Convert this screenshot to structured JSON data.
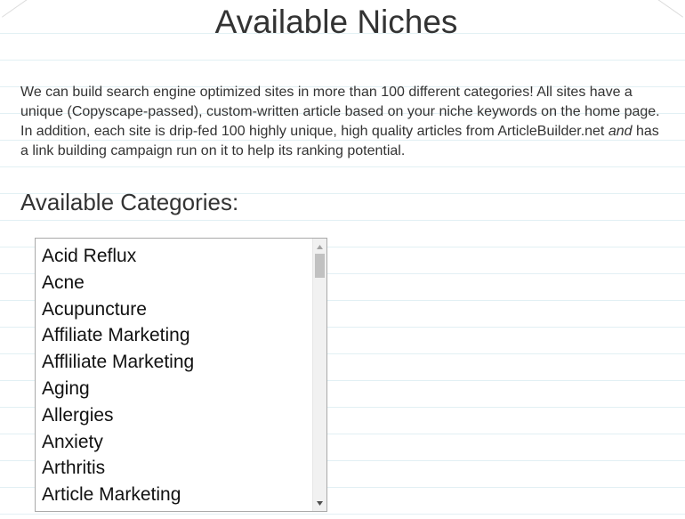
{
  "page": {
    "title": "Available Niches"
  },
  "intro": {
    "text_before": "We can build search engine optimized sites in more than 100 different categories! All sites have a unique (Copyscape-passed), custom-written article based on your niche keywords on the home page. In addition, each site is drip-fed 100 highly unique, high quality articles from ArticleBuilder.net ",
    "emphasis": "and",
    "text_after": " has a link building campaign run on it to help its ranking potential."
  },
  "categories": {
    "heading": "Available Categories:",
    "items": [
      "Acid Reflux",
      "Acne",
      "Acupuncture",
      "Affiliate Marketing",
      "Affliliate Marketing",
      "Aging",
      "Allergies",
      "Anxiety",
      "Arthritis",
      "Article Marketing"
    ]
  },
  "icons": {
    "scroll_up": "triangle-up-icon",
    "scroll_down": "triangle-down-icon"
  },
  "colors": {
    "text": "#333333",
    "rule_lines": "#e2f0f4",
    "border": "#a9a9a9",
    "scroll_thumb": "#c1c1c1"
  }
}
